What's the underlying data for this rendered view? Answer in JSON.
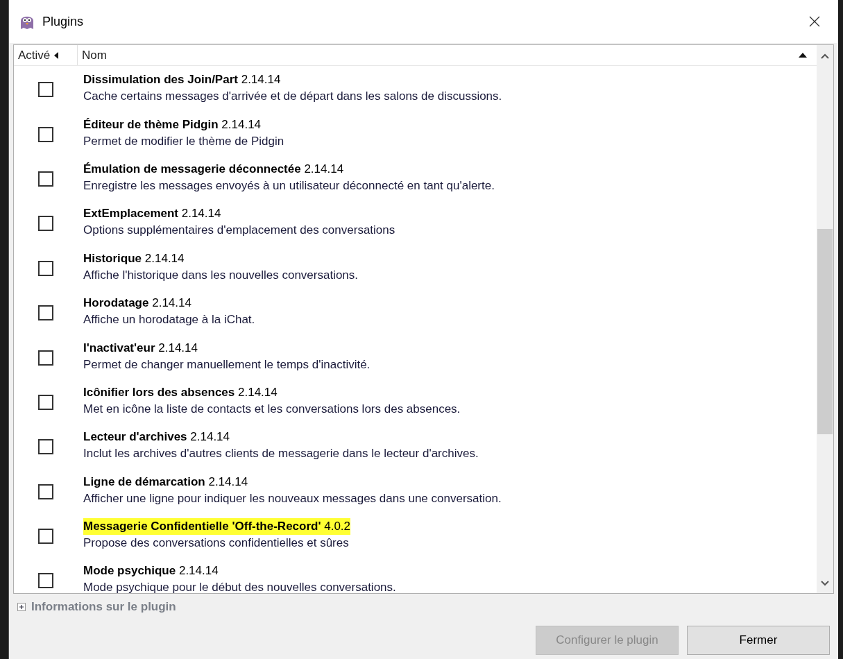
{
  "window": {
    "title": "Plugins"
  },
  "columns": [
    {
      "label": "Activé"
    },
    {
      "label": "Nom"
    }
  ],
  "plugins": [
    {
      "name": "Dissimulation des Join/Part",
      "version": "2.14.14",
      "description": "Cache certains messages d'arrivée et de départ dans les salons de discussions.",
      "enabled": false,
      "highlighted": false
    },
    {
      "name": "Éditeur de thème Pidgin",
      "version": "2.14.14",
      "description": "Permet de modifier le thème de Pidgin",
      "enabled": false,
      "highlighted": false
    },
    {
      "name": "Émulation de messagerie déconnectée",
      "version": "2.14.14",
      "description": "Enregistre les messages envoyés à un utilisateur déconnecté en tant qu'alerte.",
      "enabled": false,
      "highlighted": false
    },
    {
      "name": "ExtEmplacement",
      "version": "2.14.14",
      "description": "Options supplémentaires d'emplacement des conversations",
      "enabled": false,
      "highlighted": false
    },
    {
      "name": "Historique",
      "version": "2.14.14",
      "description": "Affiche l'historique dans les nouvelles conversations.",
      "enabled": false,
      "highlighted": false
    },
    {
      "name": "Horodatage",
      "version": "2.14.14",
      "description": "Affiche un horodatage à la iChat.",
      "enabled": false,
      "highlighted": false
    },
    {
      "name": "I'nactivat'eur",
      "version": "2.14.14",
      "description": "Permet de changer manuellement le temps d'inactivité.",
      "enabled": false,
      "highlighted": false
    },
    {
      "name": "Icônifier lors des absences",
      "version": "2.14.14",
      "description": "Met en icône la liste de contacts et les conversations lors des absences.",
      "enabled": false,
      "highlighted": false
    },
    {
      "name": "Lecteur d'archives",
      "version": "2.14.14",
      "description": "Inclut les archives d'autres clients de messagerie dans le lecteur d'archives.",
      "enabled": false,
      "highlighted": false
    },
    {
      "name": "Ligne de démarcation",
      "version": "2.14.14",
      "description": "Afficher une ligne pour indiquer les nouveaux messages dans une conversation.",
      "enabled": false,
      "highlighted": false
    },
    {
      "name": "Messagerie Confidentielle 'Off-the-Record'",
      "version": "4.0.2",
      "description": "Propose des conversations confidentielles et sûres",
      "enabled": false,
      "highlighted": true
    },
    {
      "name": "Mode psychique",
      "version": "2.14.14",
      "description": "Mode psychique pour le début des nouvelles conversations.",
      "enabled": false,
      "highlighted": false
    }
  ],
  "info_expander": {
    "label": "Informations sur le plugin",
    "expanded": false
  },
  "buttons": [
    {
      "label": "Configurer le plugin",
      "disabled": true
    },
    {
      "label": "Fermer",
      "disabled": false
    }
  ]
}
